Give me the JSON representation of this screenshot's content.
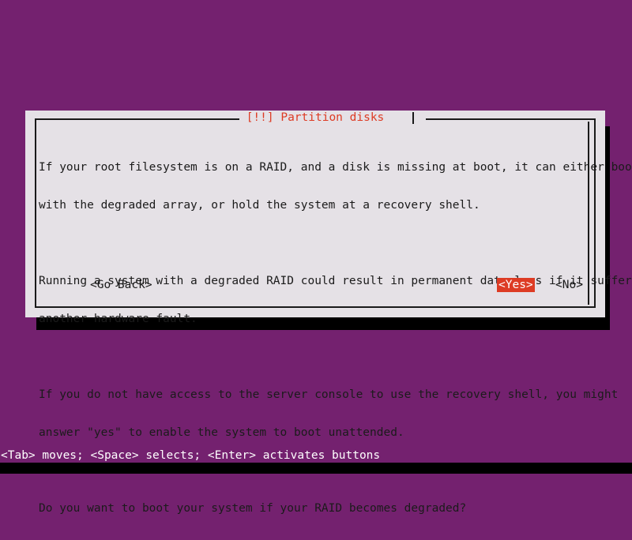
{
  "screen": {
    "background_color": "#74216f",
    "text_color": "#ffffff"
  },
  "dialog": {
    "title": "[!!] Partition disks",
    "title_color": "#dd3b24",
    "background_color": "#e5e1e6",
    "border_color": "#1a1a1a",
    "paragraphs": [
      {
        "lines": [
          "If your root filesystem is on a RAID, and a disk is missing at boot, it can either boot",
          "with the degraded array, or hold the system at a recovery shell."
        ]
      },
      {
        "lines": [
          "Running a system with a degraded RAID could result in permanent data loss if it suffers",
          "another hardware fault."
        ]
      },
      {
        "lines": [
          "If you do not have access to the server console to use the recovery shell, you might",
          "answer \"yes\" to enable the system to boot unattended."
        ]
      },
      {
        "lines": [
          "Do you want to boot your system if your RAID becomes degraded?"
        ]
      }
    ],
    "buttons": {
      "go_back": "<Go Back>",
      "yes": "<Yes>",
      "no": "<No>",
      "selected": "yes",
      "highlight_background": "#dd3b24",
      "highlight_foreground": "#ffffff"
    }
  },
  "status_bar": {
    "hint": "<Tab> moves; <Space> selects; <Enter> activates buttons"
  }
}
